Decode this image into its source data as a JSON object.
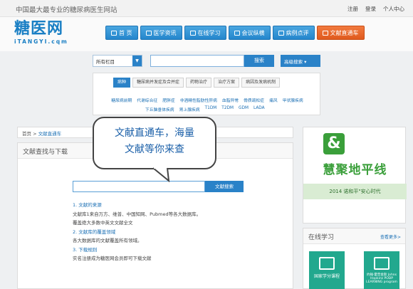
{
  "top": {
    "tagline": "中国最大最专业的糖尿病医生网站",
    "links": [
      "注册",
      "登录",
      "个人中心"
    ]
  },
  "logo": {
    "cn": "糖医网",
    "en": "iTANGYI.cqm"
  },
  "nav": [
    {
      "label": "首 页",
      "icon": "home-icon"
    },
    {
      "label": "医学资讯",
      "icon": "news-icon"
    },
    {
      "label": "在线学习",
      "icon": "book-icon"
    },
    {
      "label": "会议纵横",
      "icon": "meeting-icon"
    },
    {
      "label": "病例点评",
      "icon": "case-icon"
    },
    {
      "label": "文献直通车",
      "icon": "document-icon"
    }
  ],
  "search": {
    "category": "所有栏目",
    "button": "搜索",
    "advanced": "高级搜索"
  },
  "categories": {
    "tabs": [
      "病种",
      "糖尿病并发症及合并症",
      "药物治疗",
      "治疗方案",
      "病因及发病机制"
    ],
    "row1": [
      "糖尿病前期",
      "代谢综合征",
      "肥胖症",
      "非酒精性脂肪性肝病",
      "血脂异常",
      "骨质疏松症",
      "痛风",
      "甲状腺疾病"
    ],
    "row2": [
      "下丘脑垂体疾病",
      "肾上腺疾病",
      "T1DM",
      "T2DM",
      "GDM",
      "LADA"
    ]
  },
  "breadcrumb": {
    "home": "首页",
    "current": "文献直通车"
  },
  "main": {
    "title": "文献查找与下载",
    "bubble_line1": "文献直通车，海量",
    "bubble_line2": "文献等你来查",
    "search_button": "文献搜索",
    "items": [
      {
        "heading": "1. 文献的来源",
        "text": "文献库1来自万方、维普、中国知网、Pubmed等各大数据库。"
      },
      {
        "heading": "",
        "text": "覆盖绝大多数中英文文献全文"
      },
      {
        "heading": "2. 文献库的覆盖领域",
        "text": "各大数据库的文献覆盖所有领域。"
      },
      {
        "heading": "3. 下载规则",
        "text": "实名注册成为糖医网会员即可下载文献"
      }
    ]
  },
  "banner": {
    "title": "慧聚地平线",
    "subtitle": "2014 诺和平\"安心时代"
  },
  "learn": {
    "title": "在线学习",
    "more": "查看更多>",
    "tiles": [
      "国家学分课程",
      "约翰·霍普金斯 Johns Hopkins PODP LEARNING program"
    ]
  }
}
